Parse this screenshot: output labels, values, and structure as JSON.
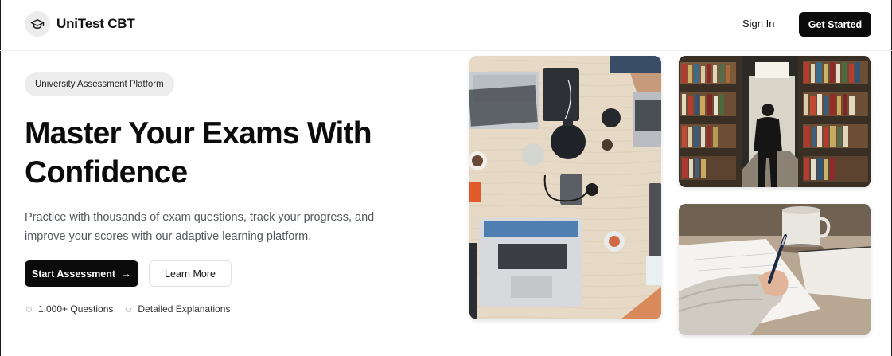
{
  "header": {
    "brand": "UniTest CBT",
    "sign_in": "Sign In",
    "get_started": "Get Started"
  },
  "hero": {
    "badge": "University Assessment Platform",
    "title_line1": "Master Your Exams With",
    "title_line2": "Confidence",
    "description_line1": "Practice with thousands of exam questions, track your progress, and",
    "description_line2": "improve your scores with our adaptive learning platform.",
    "primary_cta": "Start Assessment",
    "secondary_cta": "Learn More",
    "features": [
      "1,000+ Questions",
      "Detailed Explanations"
    ]
  },
  "icons": {
    "logo": "graduation-cap-icon",
    "cta_arrow": "arrow-right-icon"
  },
  "colors": {
    "primary": "#0b0b0b",
    "badge_bg": "#ededed",
    "text_muted": "#555a60"
  }
}
